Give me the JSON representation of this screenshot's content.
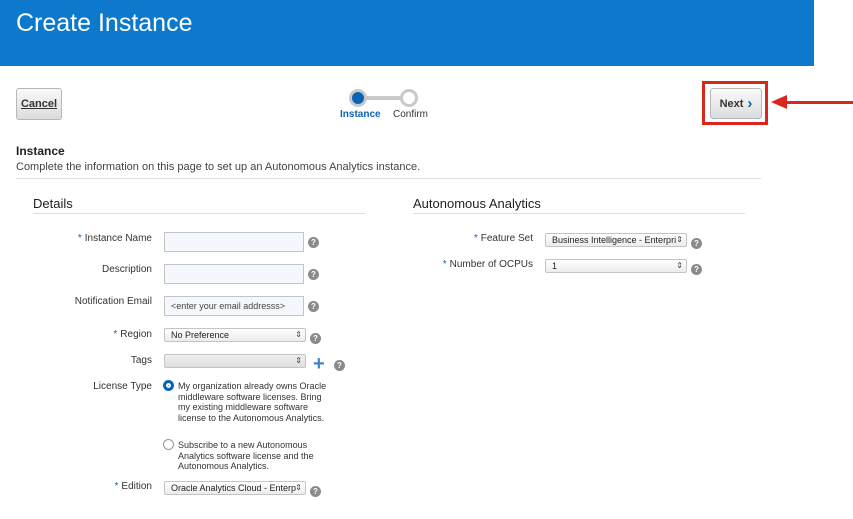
{
  "header": {
    "title": "Create Instance"
  },
  "toolbar": {
    "cancel_label": "Cancel",
    "next_label": "Next"
  },
  "train": {
    "steps": [
      {
        "label": "Instance",
        "active": true
      },
      {
        "label": "Confirm",
        "active": false
      }
    ]
  },
  "section": {
    "title": "Instance",
    "description": "Complete the information on this page to set up an Autonomous Analytics instance."
  },
  "details": {
    "title": "Details",
    "instance_name": {
      "label": "Instance Name",
      "value": ""
    },
    "description": {
      "label": "Description",
      "value": ""
    },
    "notification_email": {
      "label": "Notification Email",
      "placeholder": "<enter your email addresss>"
    },
    "region": {
      "label": "Region",
      "value": "No Preference"
    },
    "tags": {
      "label": "Tags",
      "value": ""
    },
    "license_type": {
      "label": "License Type",
      "options": [
        {
          "text": "My organization already owns Oracle middleware software licenses. Bring my existing middleware software license to the Autonomous Analytics.",
          "selected": true
        },
        {
          "text": "Subscribe to a new Autonomous Analytics software license and the Autonomous Analytics.",
          "selected": false
        }
      ]
    },
    "edition": {
      "label": "Edition",
      "value": "Oracle Analytics Cloud - Enterp"
    }
  },
  "analytics": {
    "title": "Autonomous Analytics",
    "feature_set": {
      "label": "Feature Set",
      "value": "Business Intelligence - Enterpri"
    },
    "ocpus": {
      "label": "Number of OCPUs",
      "value": "1"
    }
  },
  "required_marker": "*",
  "help_glyph": "?",
  "colors": {
    "header": "#0d79cc",
    "accent": "#0b63b5",
    "callout": "#d9271e"
  }
}
